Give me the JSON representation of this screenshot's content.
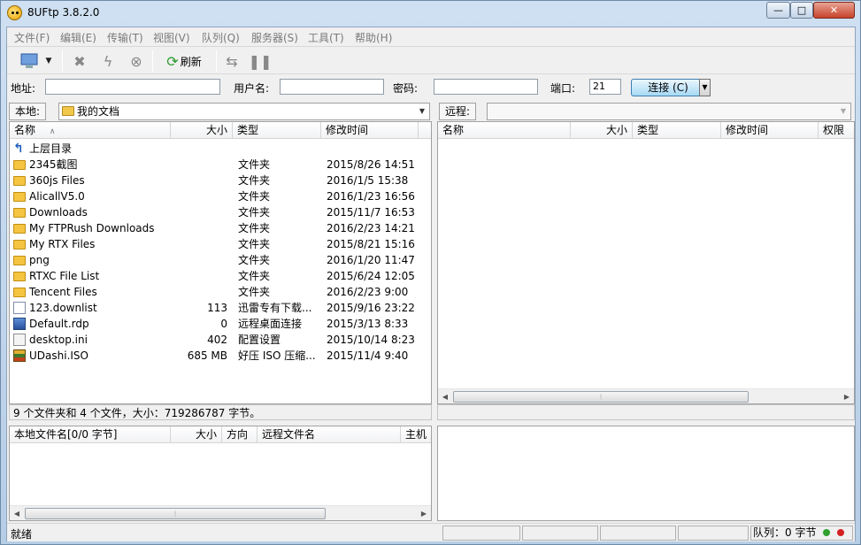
{
  "window": {
    "title": "8UFtp 3.8.2.0",
    "min": "—",
    "max": "□",
    "close": "✕"
  },
  "menu": [
    "文件(F)",
    "编辑(E)",
    "传输(T)",
    "视图(V)",
    "队列(Q)",
    "服务器(S)",
    "工具(T)",
    "帮助(H)"
  ],
  "toolbar": {
    "refresh_label": "刷新"
  },
  "connbar": {
    "address_label": "地址:",
    "address_value": "",
    "user_label": "用户名:",
    "user_value": "",
    "password_label": "密码:",
    "password_value": "",
    "port_label": "端口:",
    "port_value": "21",
    "connect_label": "连接 (C)"
  },
  "local": {
    "label": "本地:",
    "path": "我的文档",
    "columns": [
      "名称",
      "大小",
      "类型",
      "修改时间"
    ],
    "sort_indicator": "∧",
    "parent_label": "上层目录",
    "rows": [
      {
        "name": "2345截图",
        "size": "",
        "type": "文件夹",
        "modified": "2015/8/26 14:51",
        "icon": "folder-icon"
      },
      {
        "name": "360js Files",
        "size": "",
        "type": "文件夹",
        "modified": "2016/1/5 15:38",
        "icon": "folder-icon"
      },
      {
        "name": "AlicallV5.0",
        "size": "",
        "type": "文件夹",
        "modified": "2016/1/23 16:56",
        "icon": "folder-icon"
      },
      {
        "name": "Downloads",
        "size": "",
        "type": "文件夹",
        "modified": "2015/11/7 16:53",
        "icon": "folder-icon"
      },
      {
        "name": "My FTPRush Downloads",
        "size": "",
        "type": "文件夹",
        "modified": "2016/2/23 14:21",
        "icon": "folder-icon"
      },
      {
        "name": "My RTX Files",
        "size": "",
        "type": "文件夹",
        "modified": "2015/8/21 15:16",
        "icon": "folder-icon"
      },
      {
        "name": "png",
        "size": "",
        "type": "文件夹",
        "modified": "2016/1/20 11:47",
        "icon": "folder-icon"
      },
      {
        "name": "RTXC File List",
        "size": "",
        "type": "文件夹",
        "modified": "2015/6/24 12:05",
        "icon": "folder-icon"
      },
      {
        "name": "Tencent Files",
        "size": "",
        "type": "文件夹",
        "modified": "2016/2/23 9:00",
        "icon": "folder-icon"
      },
      {
        "name": "123.downlist",
        "size": "113",
        "type": "迅雷专有下载...",
        "modified": "2015/9/16 23:22",
        "icon": "file-icon"
      },
      {
        "name": "Default.rdp",
        "size": "0",
        "type": "远程桌面连接",
        "modified": "2015/3/13 8:33",
        "icon": "rdp-icon"
      },
      {
        "name": "desktop.ini",
        "size": "402",
        "type": "配置设置",
        "modified": "2015/10/14 8:23",
        "icon": "ini-icon"
      },
      {
        "name": "UDashi.ISO",
        "size": "685 MB",
        "type": "好压 ISO 压缩...",
        "modified": "2015/11/4 9:40",
        "icon": "iso-icon"
      }
    ],
    "status": "9 个文件夹和 4 个文件，大小：719286787 字节。"
  },
  "remote": {
    "label": "远程:",
    "path": "",
    "columns": [
      "名称",
      "大小",
      "类型",
      "修改时间",
      "权限"
    ]
  },
  "queue": {
    "columns": [
      "本地文件名[0/0 字节]",
      "大小",
      "方向",
      "远程文件名",
      "主机"
    ]
  },
  "statusbar": {
    "left": "就绪",
    "queue": "队列：0 字节"
  },
  "colors": {
    "led_green": "#2da02d",
    "led_red": "#d42020",
    "connect_border": "#3c7fb1"
  }
}
